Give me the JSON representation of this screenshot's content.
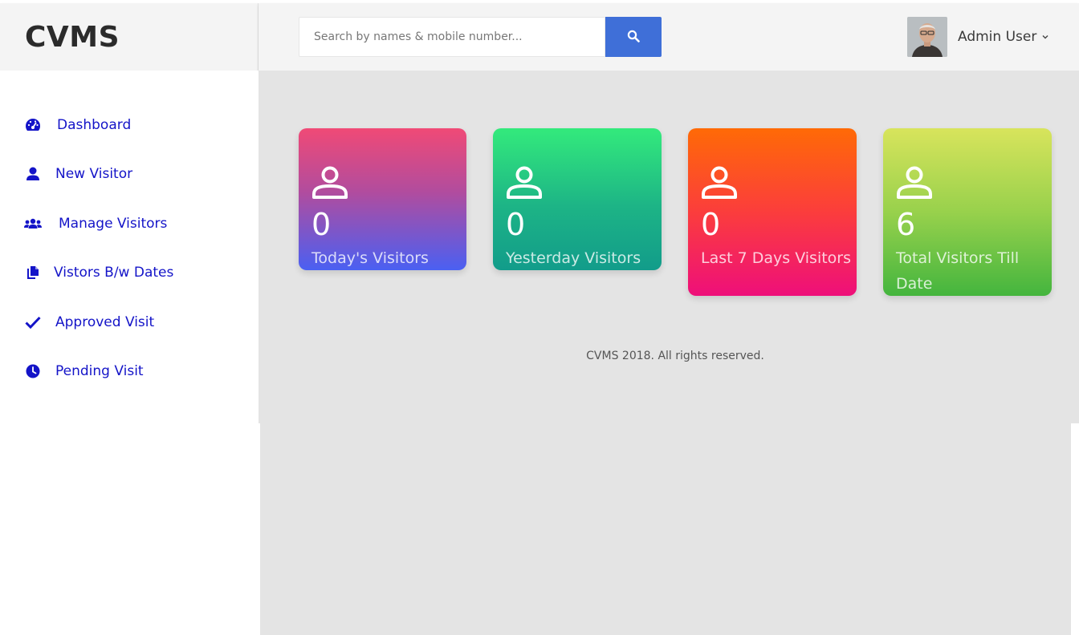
{
  "brand": {
    "name": "CVMS"
  },
  "search": {
    "placeholder": "Search by names & mobile number..."
  },
  "user": {
    "name": "Admin User"
  },
  "sidebar": {
    "items": [
      {
        "label": "Dashboard",
        "icon": "dashboard-icon"
      },
      {
        "label": "New Visitor",
        "icon": "user-icon"
      },
      {
        "label": "Manage Visitors",
        "icon": "users-icon"
      },
      {
        "label": "Vistors B/w Dates",
        "icon": "files-icon"
      },
      {
        "label": "Approved Visit",
        "icon": "check-icon"
      },
      {
        "label": "Pending Visit",
        "icon": "clock-icon"
      }
    ]
  },
  "cards": [
    {
      "count": "0",
      "label": "Today's Visitors",
      "icon": "person-icon"
    },
    {
      "count": "0",
      "label": "Yesterday Visitors",
      "icon": "person-icon"
    },
    {
      "count": "0",
      "label": "Last 7 Days Visitors",
      "icon": "person-icon"
    },
    {
      "count": "6",
      "label": "Total Visitors Till Date",
      "icon": "person-icon"
    }
  ],
  "footer": {
    "text": "CVMS 2018. All rights reserved."
  },
  "colors": {
    "accent": "#3f6fd8",
    "nav_link": "#1414c8",
    "content_bg": "#e4e4e4",
    "header_bg": "#f4f4f4"
  }
}
